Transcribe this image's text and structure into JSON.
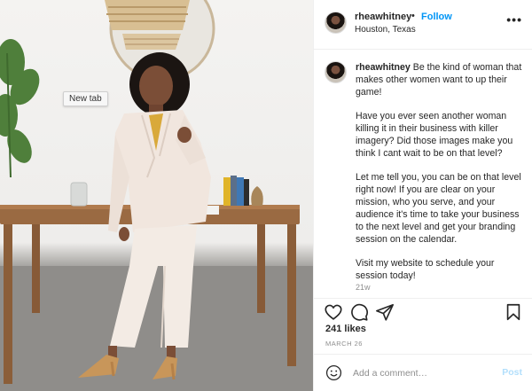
{
  "photo": {
    "tooltip": "New tab"
  },
  "header": {
    "username": "rheawhitney",
    "separator": "•",
    "follow_label": "Follow",
    "location": "Houston, Texas",
    "more_icon": "more-options-icon"
  },
  "caption": {
    "username": "rheawhitney",
    "paragraphs": [
      "Be the kind of woman that makes other women want to up their game!",
      "Have you ever seen another woman killing it in their business with killer imagery? Did those images make you think I cant wait to be on that level?",
      "Let me tell you, you can be on that level right now! If you are clear on your mission, who you serve, and your audience it's time to take your business to the next level and get your branding session on the calendar.",
      "Visit my website to schedule your session today!"
    ],
    "age": "21w"
  },
  "actions": {
    "like_icon": "heart-icon",
    "comment_icon": "comment-icon",
    "share_icon": "share-icon",
    "save_icon": "bookmark-icon",
    "likes": "241 likes",
    "date": "MARCH 26"
  },
  "comment_box": {
    "emoji_icon": "emoji-icon",
    "placeholder": "Add a comment…",
    "post_label": "Post"
  },
  "colors": {
    "link": "#0095f6",
    "post_disabled": "#b2dffc",
    "muted": "#8e8e8e",
    "text": "#262626"
  }
}
